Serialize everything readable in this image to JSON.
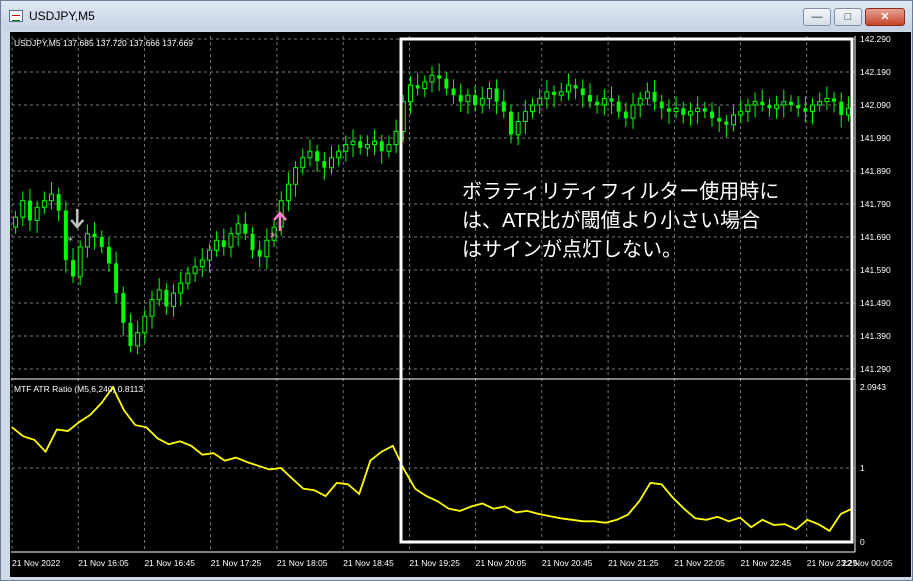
{
  "window": {
    "title": "USDJPY,M5",
    "min_label": "—",
    "max_label": "□",
    "close_label": "✕"
  },
  "colors": {
    "background": "#000000",
    "bull": "#00ff00",
    "bear": "#00ff00",
    "grid": "#a0a0a0",
    "atr_line": "#ffff00",
    "annotation": "#ffffff",
    "buy_arrow": "#ff80d0",
    "sell_arrow": "#c0c0c0"
  },
  "main_chart": {
    "header": "USDJPY,M5  137.685 137.720 137.666 137.669",
    "ylim": [
      141.29,
      142.29
    ],
    "y_ticks": [
      "142.290",
      "142.190",
      "142.090",
      "141.990",
      "141.890",
      "141.790",
      "141.690",
      "141.590",
      "141.490",
      "141.390",
      "141.290"
    ]
  },
  "sub_chart": {
    "header": "MTF ATR Ratio (M5,6,240) 0.8113",
    "y_ticks": [
      "2.0943",
      "1",
      "0"
    ]
  },
  "x_ticks": [
    "21 Nov 2022",
    "21 Nov 16:05",
    "21 Nov 16:45",
    "21 Nov 17:25",
    "21 Nov 18:05",
    "21 Nov 18:45",
    "21 Nov 19:25",
    "21 Nov 20:05",
    "21 Nov 20:45",
    "21 Nov 21:25",
    "21 Nov 22:05",
    "21 Nov 22:45",
    "21 Nov 23:25",
    "22 Nov 00:05"
  ],
  "annotation": {
    "lines": [
      "ボラティリティフィルター使用時に",
      "は、ATR比が閾値より小さい場合",
      "はサインが点灯しない。"
    ]
  },
  "chart_data": [
    {
      "type": "candlestick",
      "title": "USDJPY,M5",
      "ylim": [
        141.29,
        142.29
      ],
      "closes": [
        141.75,
        141.8,
        141.74,
        141.78,
        141.8,
        141.82,
        141.77,
        141.62,
        141.57,
        141.66,
        141.7,
        141.69,
        141.66,
        141.61,
        141.52,
        141.43,
        141.36,
        141.4,
        141.45,
        141.5,
        141.53,
        141.48,
        141.52,
        141.55,
        141.58,
        141.6,
        141.62,
        141.65,
        141.68,
        141.66,
        141.7,
        141.73,
        141.7,
        141.65,
        141.63,
        141.68,
        141.72,
        141.8,
        141.85,
        141.9,
        141.93,
        141.95,
        141.92,
        141.9,
        141.93,
        141.95,
        141.97,
        141.98,
        141.96,
        141.97,
        141.98,
        141.95,
        141.97,
        142.01,
        142.1,
        142.15,
        142.14,
        142.16,
        142.18,
        142.17,
        142.14,
        142.12,
        142.1,
        142.12,
        142.09,
        142.11,
        142.14,
        142.1,
        142.07,
        142.0,
        142.04,
        142.07,
        142.09,
        142.11,
        142.13,
        142.12,
        142.13,
        142.15,
        142.14,
        142.12,
        142.1,
        142.09,
        142.11,
        142.1,
        142.07,
        142.05,
        142.09,
        142.11,
        142.13,
        142.1,
        142.08,
        142.07,
        142.08,
        142.06,
        142.07,
        142.08,
        142.07,
        142.05,
        142.04,
        142.03,
        142.06,
        142.07,
        142.09,
        142.1,
        142.09,
        142.08,
        142.09,
        142.1,
        142.09,
        142.08,
        142.07,
        142.09,
        142.1,
        142.11,
        142.1,
        142.06,
        142.08
      ],
      "markers": [
        {
          "type": "sell",
          "bar": 9
        },
        {
          "type": "buy",
          "bar": 36
        }
      ]
    },
    {
      "type": "line",
      "title": "MTF ATR Ratio (M5,6,240)",
      "ylim": [
        0,
        2.0943
      ],
      "last_value": 0.8113,
      "values": [
        1.55,
        1.43,
        1.38,
        1.22,
        1.52,
        1.5,
        1.62,
        1.72,
        1.88,
        2.09,
        1.78,
        1.58,
        1.55,
        1.4,
        1.32,
        1.36,
        1.3,
        1.18,
        1.2,
        1.1,
        1.14,
        1.08,
        1.03,
        0.98,
        1.0,
        0.86,
        0.72,
        0.7,
        0.62,
        0.8,
        0.78,
        0.65,
        1.1,
        1.22,
        1.3,
        0.98,
        0.72,
        0.62,
        0.55,
        0.45,
        0.42,
        0.48,
        0.52,
        0.45,
        0.48,
        0.4,
        0.42,
        0.38,
        0.35,
        0.32,
        0.3,
        0.28,
        0.28,
        0.26,
        0.3,
        0.37,
        0.55,
        0.8,
        0.78,
        0.6,
        0.45,
        0.32,
        0.3,
        0.34,
        0.28,
        0.33,
        0.2,
        0.3,
        0.23,
        0.24,
        0.17,
        0.3,
        0.24,
        0.15,
        0.38,
        0.45
      ]
    }
  ]
}
